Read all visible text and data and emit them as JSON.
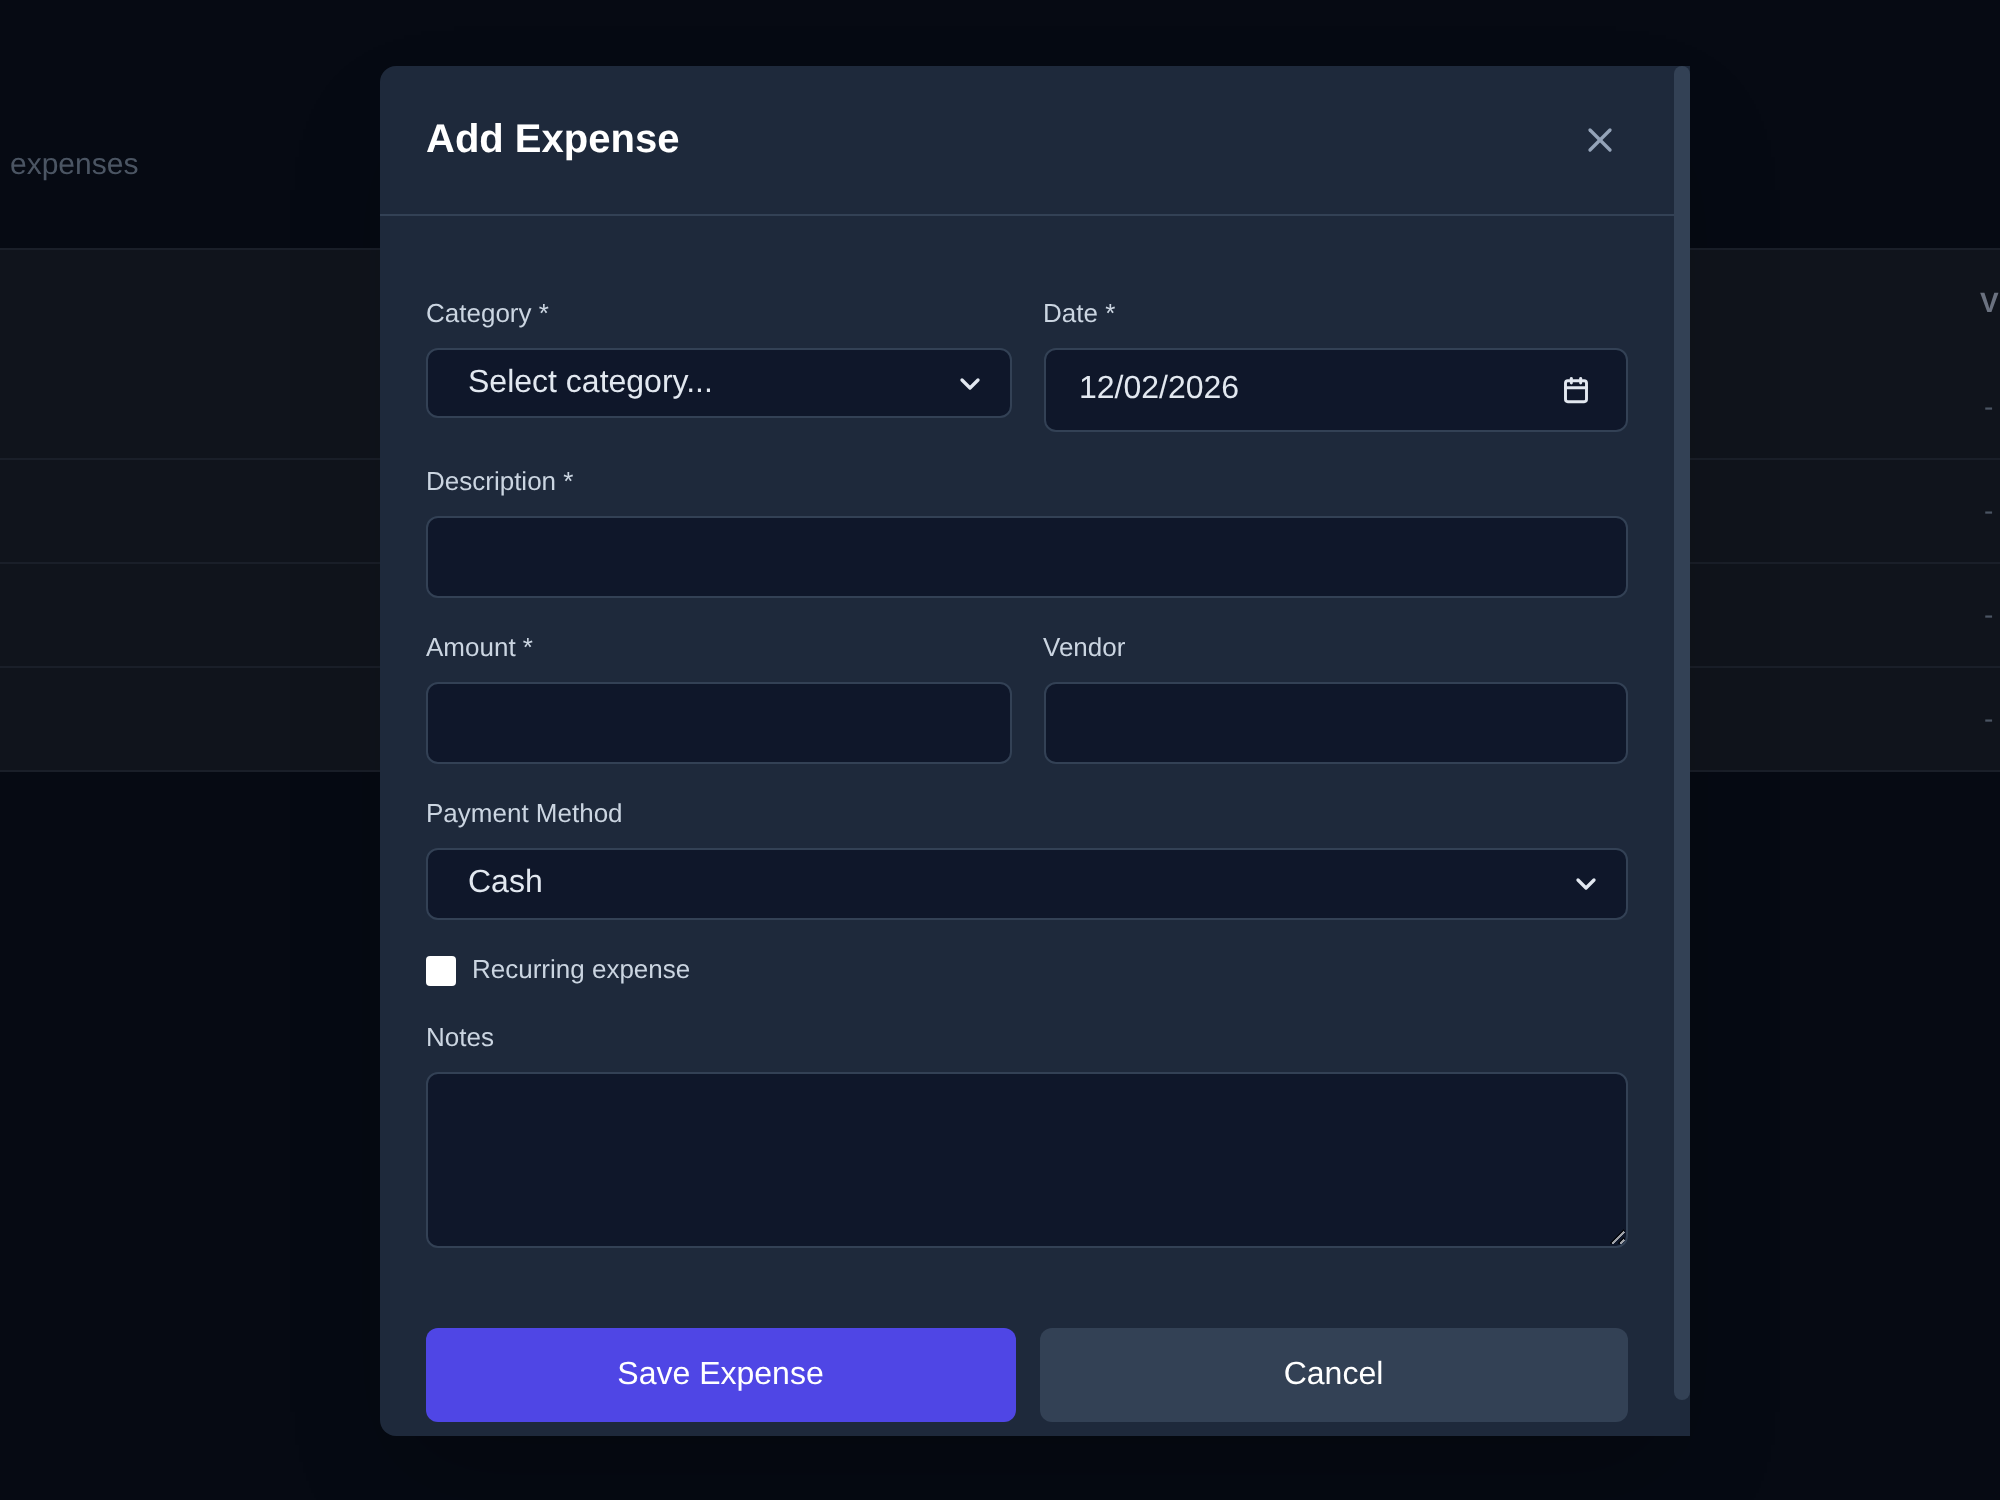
{
  "background": {
    "subtitle": "expenses",
    "table": {
      "columns": [
        "V"
      ],
      "rows": [
        [
          "-"
        ],
        [
          "-"
        ],
        [
          "-"
        ],
        [
          "-"
        ]
      ]
    }
  },
  "dialog": {
    "title": "Add Expense",
    "rows": [
      [
        {
          "kind": "select",
          "label": "Category *",
          "value": "Select category..."
        },
        {
          "kind": "date",
          "label": "Date *",
          "value": "12/02/2026"
        }
      ],
      [
        {
          "kind": "text",
          "label": "Description *"
        }
      ],
      [
        {
          "kind": "text",
          "label": "Amount *"
        },
        {
          "kind": "text",
          "label": "Vendor"
        }
      ],
      [
        {
          "kind": "select",
          "label": "Payment Method",
          "value": "Cash"
        }
      ],
      [
        {
          "kind": "checkbox",
          "label": "Recurring expense",
          "checked": false
        }
      ],
      [
        {
          "kind": "textarea",
          "label": "Notes"
        }
      ]
    ],
    "buttons": [
      {
        "kind": "primary",
        "label": "Save Expense"
      },
      {
        "kind": "secondary",
        "label": "Cancel"
      }
    ]
  }
}
